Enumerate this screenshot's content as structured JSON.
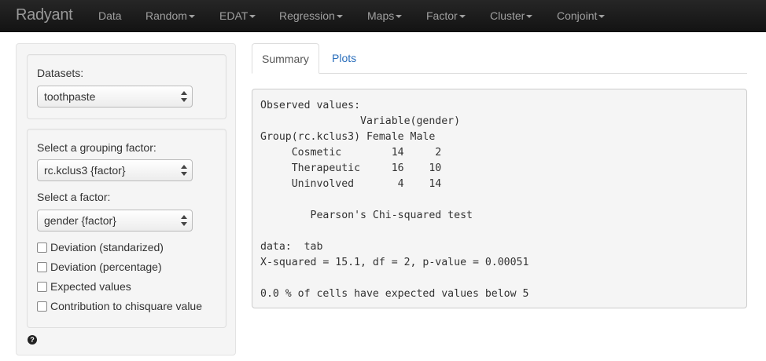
{
  "app": {
    "brand": "Radyant",
    "nav": [
      {
        "label": "Data",
        "dropdown": false
      },
      {
        "label": "Random",
        "dropdown": true
      },
      {
        "label": "EDAT",
        "dropdown": true
      },
      {
        "label": "Regression",
        "dropdown": true
      },
      {
        "label": "Maps",
        "dropdown": true
      },
      {
        "label": "Factor",
        "dropdown": true
      },
      {
        "label": "Cluster",
        "dropdown": true
      },
      {
        "label": "Conjoint",
        "dropdown": true
      }
    ]
  },
  "sidebar": {
    "datasets_label": "Datasets:",
    "datasets_value": "toothpaste",
    "grouping_label": "Select a grouping factor:",
    "grouping_value": "rc.kclus3 {factor}",
    "factor_label": "Select a factor:",
    "factor_value": "gender {factor}",
    "checkboxes": [
      {
        "label": "Deviation (standarized)",
        "checked": false
      },
      {
        "label": "Deviation (percentage)",
        "checked": false
      },
      {
        "label": "Expected values",
        "checked": false
      },
      {
        "label": "Contribution to chisquare value",
        "checked": false
      }
    ],
    "help_glyph": "?"
  },
  "tabs": [
    {
      "label": "Summary",
      "active": true
    },
    {
      "label": "Plots",
      "active": false
    }
  ],
  "output": {
    "text": "Observed values:\n                Variable(gender)\nGroup(rc.kclus3) Female Male\n     Cosmetic        14     2\n     Therapeutic     16    10\n     Uninvolved       4    14\n\n        Pearson's Chi-squared test\n\ndata:  tab\nX-squared = 15.1, df = 2, p-value = 0.00051\n\n0.0 % of cells have expected values below 5"
  },
  "colors": {
    "navbar": "#1b1b1b",
    "link": "#2a6ebb",
    "well": "#f5f5f5"
  }
}
